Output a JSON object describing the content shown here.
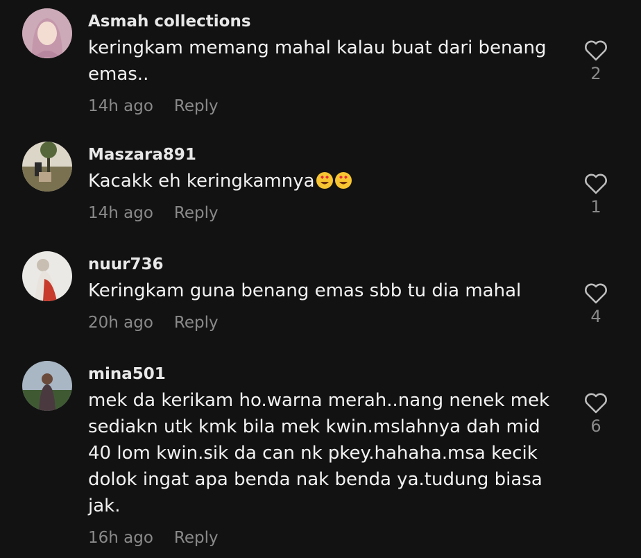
{
  "comments": [
    {
      "username": "Asmah collections",
      "text": "keringkam memang mahal kalau buat dari benang\nemas..",
      "time": "14h ago",
      "reply_label": "Reply",
      "likes": "2",
      "avatar_colors": [
        "#c9a7b6",
        "#f0d9cf"
      ]
    },
    {
      "username": "Maszara891",
      "text": "Kacakk eh keringkamnya",
      "emoji": "smiling-face-with-heart-eyes x2",
      "time": "14h ago",
      "reply_label": "Reply",
      "likes": "1",
      "avatar_colors": [
        "#d7cfbf",
        "#5f6a3f"
      ]
    },
    {
      "username": "nuur736",
      "text": "Keringkam guna benang emas sbb tu dia mahal",
      "time": "20h ago",
      "reply_label": "Reply",
      "likes": "4",
      "avatar_colors": [
        "#e6e4e2",
        "#c2392e"
      ]
    },
    {
      "username": "mina501",
      "text": "mek da kerikam ho.warna merah..nang nenek mek\nsediakn utk kmk bila mek kwin.mslahnya dah mid\n40 lom kwin.sik da can nk pkey.hahaha.msa kecik\ndolok ingat apa benda nak benda ya.tudung biasa\njak.",
      "time": "16h ago",
      "reply_label": "Reply",
      "likes": "6",
      "avatar_colors": [
        "#9aa8b8",
        "#3d5a2f"
      ]
    }
  ],
  "icons": {
    "like": "heart-outline-icon"
  },
  "colors": {
    "background": "#121212",
    "muted": "#8a8a8a",
    "text": "#f2f2f2"
  }
}
